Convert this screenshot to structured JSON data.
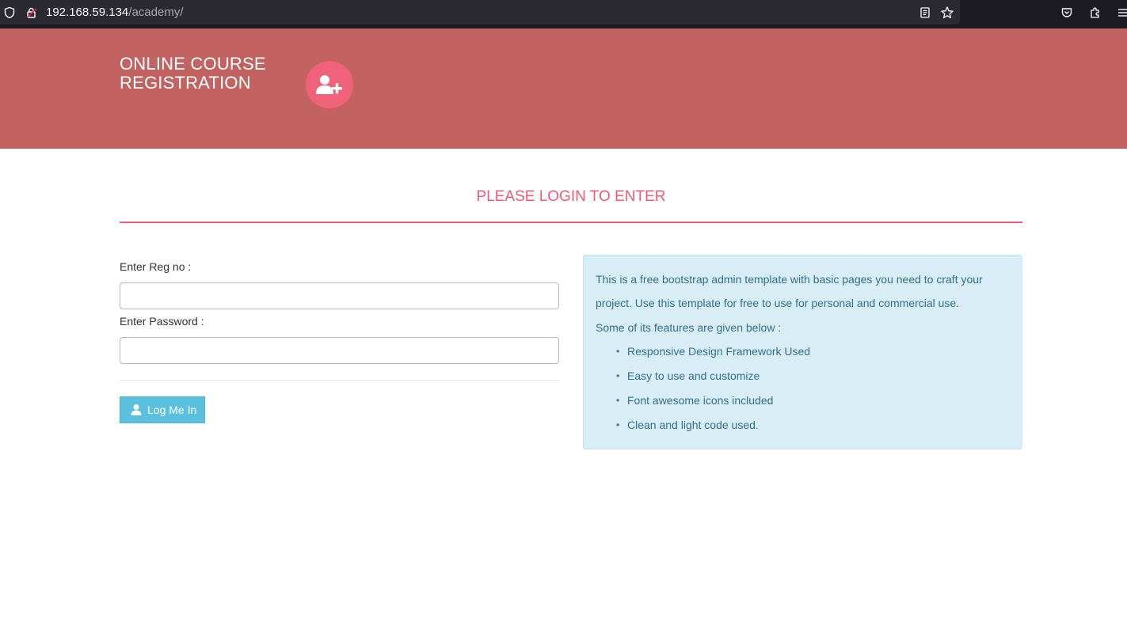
{
  "browser": {
    "url_host": "192.168.59.134",
    "url_path": "/academy/"
  },
  "header": {
    "title_line1": "ONLINE COURSE",
    "title_line2": "REGISTRATION",
    "badge_icon": "user-plus-icon",
    "bg_color": "#c26362",
    "badge_color": "#f0627a"
  },
  "main": {
    "heading": "PLEASE LOGIN TO ENTER",
    "accent_color": "#ec5a77"
  },
  "form": {
    "regno_label": "Enter Reg no :",
    "regno_value": "",
    "password_label": "Enter Password :",
    "password_value": "",
    "login_label": "Log Me In",
    "login_icon": "user-icon"
  },
  "info": {
    "description": "This is a free bootstrap admin template with basic pages you need to craft your project. Use this template for free to use for personal and commercial use.",
    "features_heading": "Some of its features are given below :",
    "features": [
      "Responsive Design Framework Used",
      "Easy to use and customize",
      "Font awesome icons included",
      "Clean and light code used."
    ]
  }
}
